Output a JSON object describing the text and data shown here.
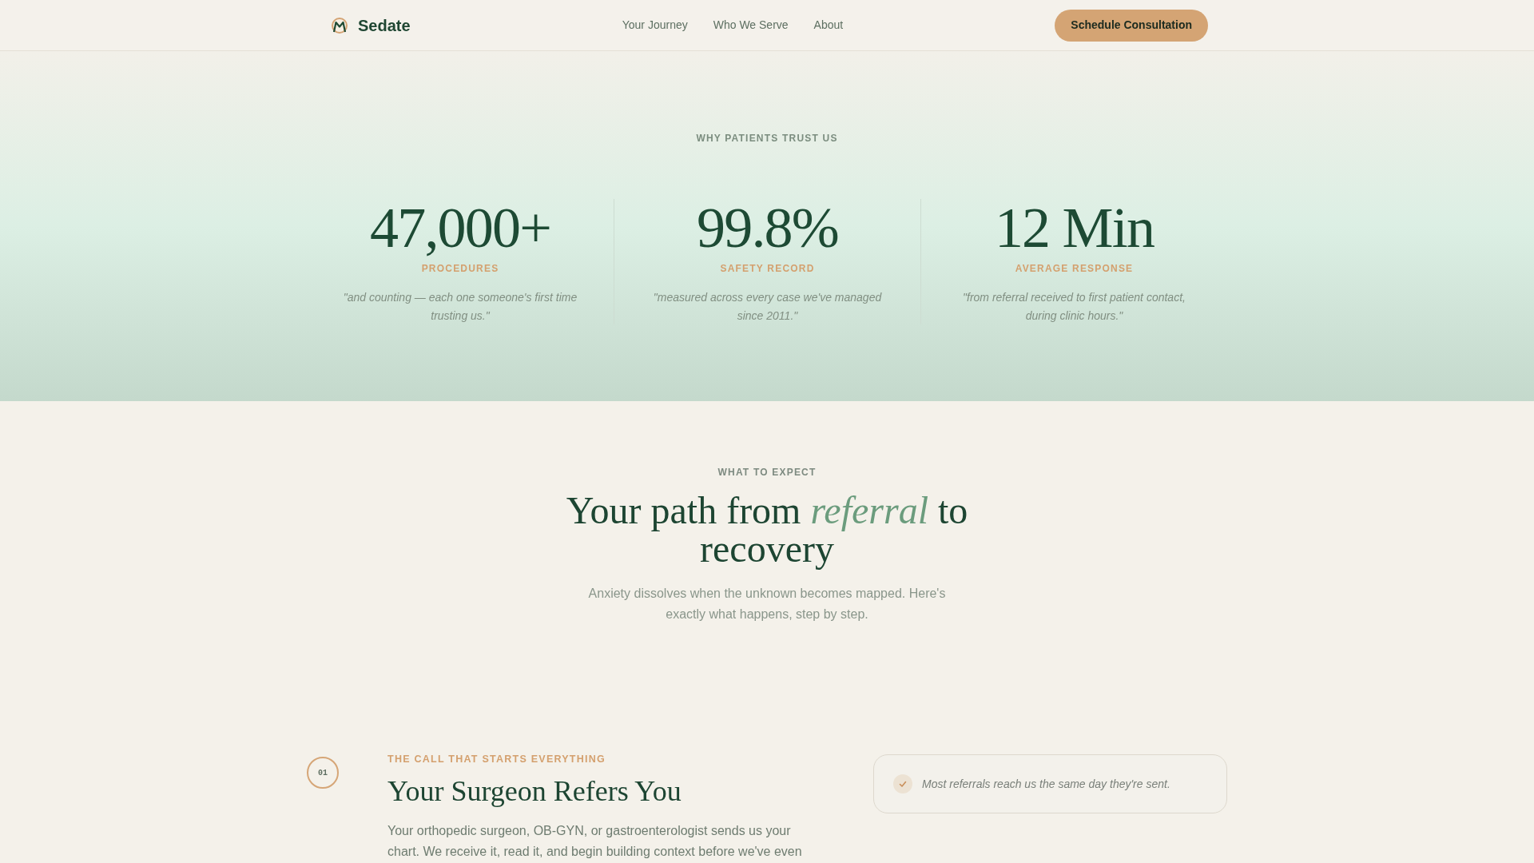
{
  "header": {
    "brand": "Sedate",
    "nav": [
      {
        "label": "Your Journey"
      },
      {
        "label": "Who We Serve"
      },
      {
        "label": "About"
      }
    ],
    "cta": "Schedule Consultation"
  },
  "stats_section": {
    "eyebrow": "WHY PATIENTS TRUST US",
    "stats": [
      {
        "value": "47,000+",
        "label": "PROCEDURES",
        "quote": "\"and counting — each one someone's first time trusting us.\""
      },
      {
        "value": "99.8%",
        "label": "SAFETY RECORD",
        "quote": "\"measured across every case we've managed since 2011.\""
      },
      {
        "value": "12 Min",
        "label": "AVERAGE RESPONSE",
        "quote": "\"from referral received to first patient contact, during clinic hours.\""
      }
    ]
  },
  "expect_section": {
    "eyebrow": "WHAT TO EXPECT",
    "heading": "Your path from *referral* to recovery",
    "intro": "Anxiety dissolves when the unknown becomes mapped. Here's exactly what happens, step by step."
  },
  "steps": [
    {
      "number": "01",
      "eyebrow": "THE CALL THAT STARTS EVERYTHING",
      "title": "Your Surgeon Refers You",
      "body": "Your orthopedic surgeon, OB-GYN, or gastroenterologist sends us your chart. We receive it, read it, and begin building context before we've even",
      "note": "Most referrals reach us the same day they're sent."
    }
  ]
}
